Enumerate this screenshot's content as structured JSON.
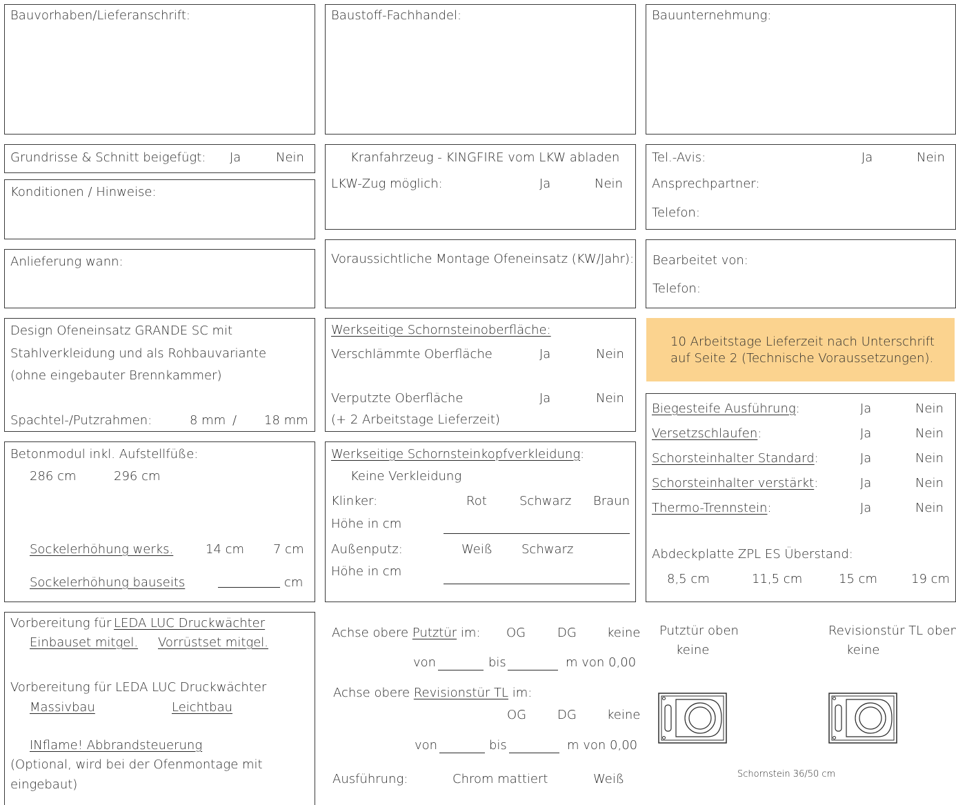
{
  "col1": {
    "bauvorhaben": "Bauvorhaben/Lieferanschrift:",
    "grundrisse": {
      "label": "Grundrisse & Schnitt beigefügt:",
      "ja": "Ja",
      "nein": "Nein"
    },
    "konditionen": "Konditionen / Hinweise:",
    "anlieferung": "Anlieferung wann:",
    "design": {
      "line1": "Design Ofeneinsatz GRANDE SC mit",
      "line2": "Stahlverkleidung und als Rohbauvariante",
      "line3": "(ohne eingebauter Brennkammer)",
      "spachtel": "Spachtel-/Putzrahmen:",
      "opt1": "8 mm",
      "slash": "/",
      "opt2": "18 mm"
    },
    "betonmodul": {
      "title": "Betonmodul inkl. Aufstellfüße:",
      "opt1": "286 cm",
      "opt2": "296 cm",
      "sockel_werks": "Sockelerhöhung werks.",
      "werks_opt1": "14 cm",
      "werks_opt2": "7 cm",
      "sockel_bauseits": "Sockelerhöhung bauseits",
      "bauseits_unit": "cm"
    },
    "vorbereitung": {
      "line1_prefix": "Vorbereitung für",
      "line1_link": "LEDA LUC Druckwächter",
      "einbauset": "Einbauset mitgel.",
      "vorruestset": "Vorrüstset mitgel.",
      "line2": "Vorbereitung für LEDA LUC Druckwächter",
      "massivbau": "Massivbau",
      "leichtbau": "Leichtbau",
      "inflame": "INflame! Abbrandsteuerung",
      "optional1": "(Optional, wird bei der Ofenmontage mit",
      "optional2": "eingebaut)"
    }
  },
  "col2": {
    "fachhandel": "Baustoff-Fachhandel:",
    "kran": "Kranfahrzeug - KINGFIRE vom LKW abladen",
    "lkw": {
      "label": "LKW-Zug möglich:",
      "ja": "Ja",
      "nein": "Nein"
    },
    "montage": "Voraussichtliche Montage Ofeneinsatz (KW/Jahr):",
    "oberflaeche": {
      "title": "Werkseitige Schornsteinoberfläche:",
      "verschlaemmt": "Verschlämmte Oberfläche",
      "verputzt": "Verputzte Oberfläche",
      "lieferzeit": "(+ 2 Arbeitstage Lieferzeit)",
      "ja": "Ja",
      "nein": "Nein"
    },
    "kopf": {
      "title": "Werkseitige Schornsteinkopfverkleidung",
      "colon": ":",
      "keine": "Keine Verkleidung",
      "klinker": "Klinker:",
      "rot": "Rot",
      "schwarz": "Schwarz",
      "braun": "Braun",
      "hoehe": "Höhe in cm",
      "aussenputz": "Außenputz:",
      "weiss": "Weiß",
      "schwarz2": "Schwarz",
      "hoehe2": "Höhe in cm"
    },
    "achse": {
      "putz_prefix": "Achse obere",
      "putz_link": "Putztür",
      "putz_suffix": "im:",
      "og": "OG",
      "dg": "DG",
      "keine": "keine",
      "von": "von",
      "bis": "bis",
      "mvon": "m von 0,00",
      "rev_prefix": "Achse obere",
      "rev_link": "Revisionstür TL",
      "rev_suffix": "im:",
      "og2": "OG",
      "dg2": "DG",
      "keine2": "keine",
      "von2": "von",
      "bis2": "bis",
      "mvon2": "m von 0,00",
      "ausfuehrung": "Ausführung:",
      "chrom": "Chrom mattiert",
      "weiss": "Weiß"
    }
  },
  "col3": {
    "bauunternehmung": "Bauunternehmung:",
    "telavis": {
      "label": "Tel.-Avis:",
      "ja": "Ja",
      "nein": "Nein"
    },
    "ansprech": "Ansprechpartner:",
    "telefon": "Telefon:",
    "bearbeitet": "Bearbeitet von:",
    "telefon2": "Telefon:",
    "note_line1": "10 Arbeitstage Lieferzeit nach Unterschrift",
    "note_line2": "auf Seite 2 (Technische Voraussetzungen).",
    "note_color": "#fbd38f",
    "options": [
      {
        "label": "Biegesteife Ausführung",
        "ja": "Ja",
        "nein": "Nein"
      },
      {
        "label": "Versetzschlaufen",
        "ja": "Ja",
        "nein": "Nein"
      },
      {
        "label": "Schorsteinhalter Standard",
        "ja": "Ja",
        "nein": "Nein"
      },
      {
        "label": "Schorsteinhalter verstärkt",
        "ja": "Ja",
        "nein": "Nein"
      },
      {
        "label": "Thermo-Trennstein",
        "ja": "Ja",
        "nein": "Nein"
      }
    ],
    "colon": ":",
    "abdeck": "Abdeckplatte ZPL ES Überstand:",
    "abdeck_opts": [
      "8,5 cm",
      "11,5 cm",
      "15 cm",
      "19 cm"
    ],
    "putztuer_oben": "Putztür oben",
    "putztuer_keine": "keine",
    "revision_oben": "Revisionstür TL oben",
    "revision_keine": "keine",
    "schornstein": "Schornstein 36/50 cm",
    "icons": [
      "chimney-cross-section-icon",
      "chimney-cross-section-icon"
    ]
  }
}
